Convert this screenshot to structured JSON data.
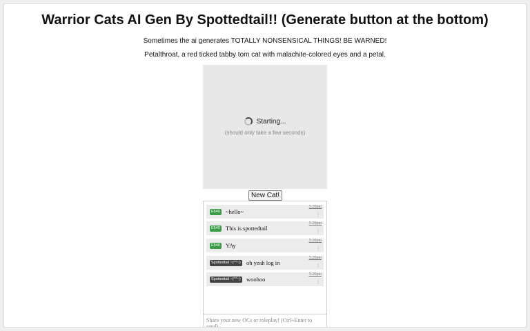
{
  "header": {
    "title": "Warrior Cats AI Gen By Spottedtail!! (Generate button at the bottom)",
    "warning": "Sometimes the ai generates TOTALLY NONSENSICAL THINGS! BE WARNED!",
    "prompt": "Petalthroat, a red ticked tabby tom cat with malachite-colored eyes and a petal."
  },
  "image_panel": {
    "status": "Starting...",
    "hint": "(should only take a few seconds)",
    "spinner_icon": "spinner-icon"
  },
  "new_cat_button": {
    "label": "New Cat!"
  },
  "chat": {
    "messages": [
      {
        "user": "E540",
        "user_color": "#3a9d4a",
        "text": "~hello~",
        "time": "5:20pm",
        "menu": "⋮"
      },
      {
        "user": "E540",
        "user_color": "#3a9d4a",
        "text": "This is spottedtail",
        "time": "5:20pm",
        "menu": "⋮"
      },
      {
        "user": "E540",
        "user_color": "#3a9d4a",
        "text": "YAy",
        "time": "5:20pm",
        "menu": "⋮"
      },
      {
        "user": "Spottedtail ~(^^~)",
        "user_color": "#444444",
        "text": "oh yeah log in",
        "time": "5:20pm",
        "menu": "⋮"
      },
      {
        "user": "Spottedtail ~(^^~)",
        "user_color": "#444444",
        "text": "woohoo",
        "time": "5:20pm",
        "menu": "⋮"
      }
    ],
    "input_placeholder": "Share your new OCs or roleplay! (Ctrl+Enter to send)"
  }
}
